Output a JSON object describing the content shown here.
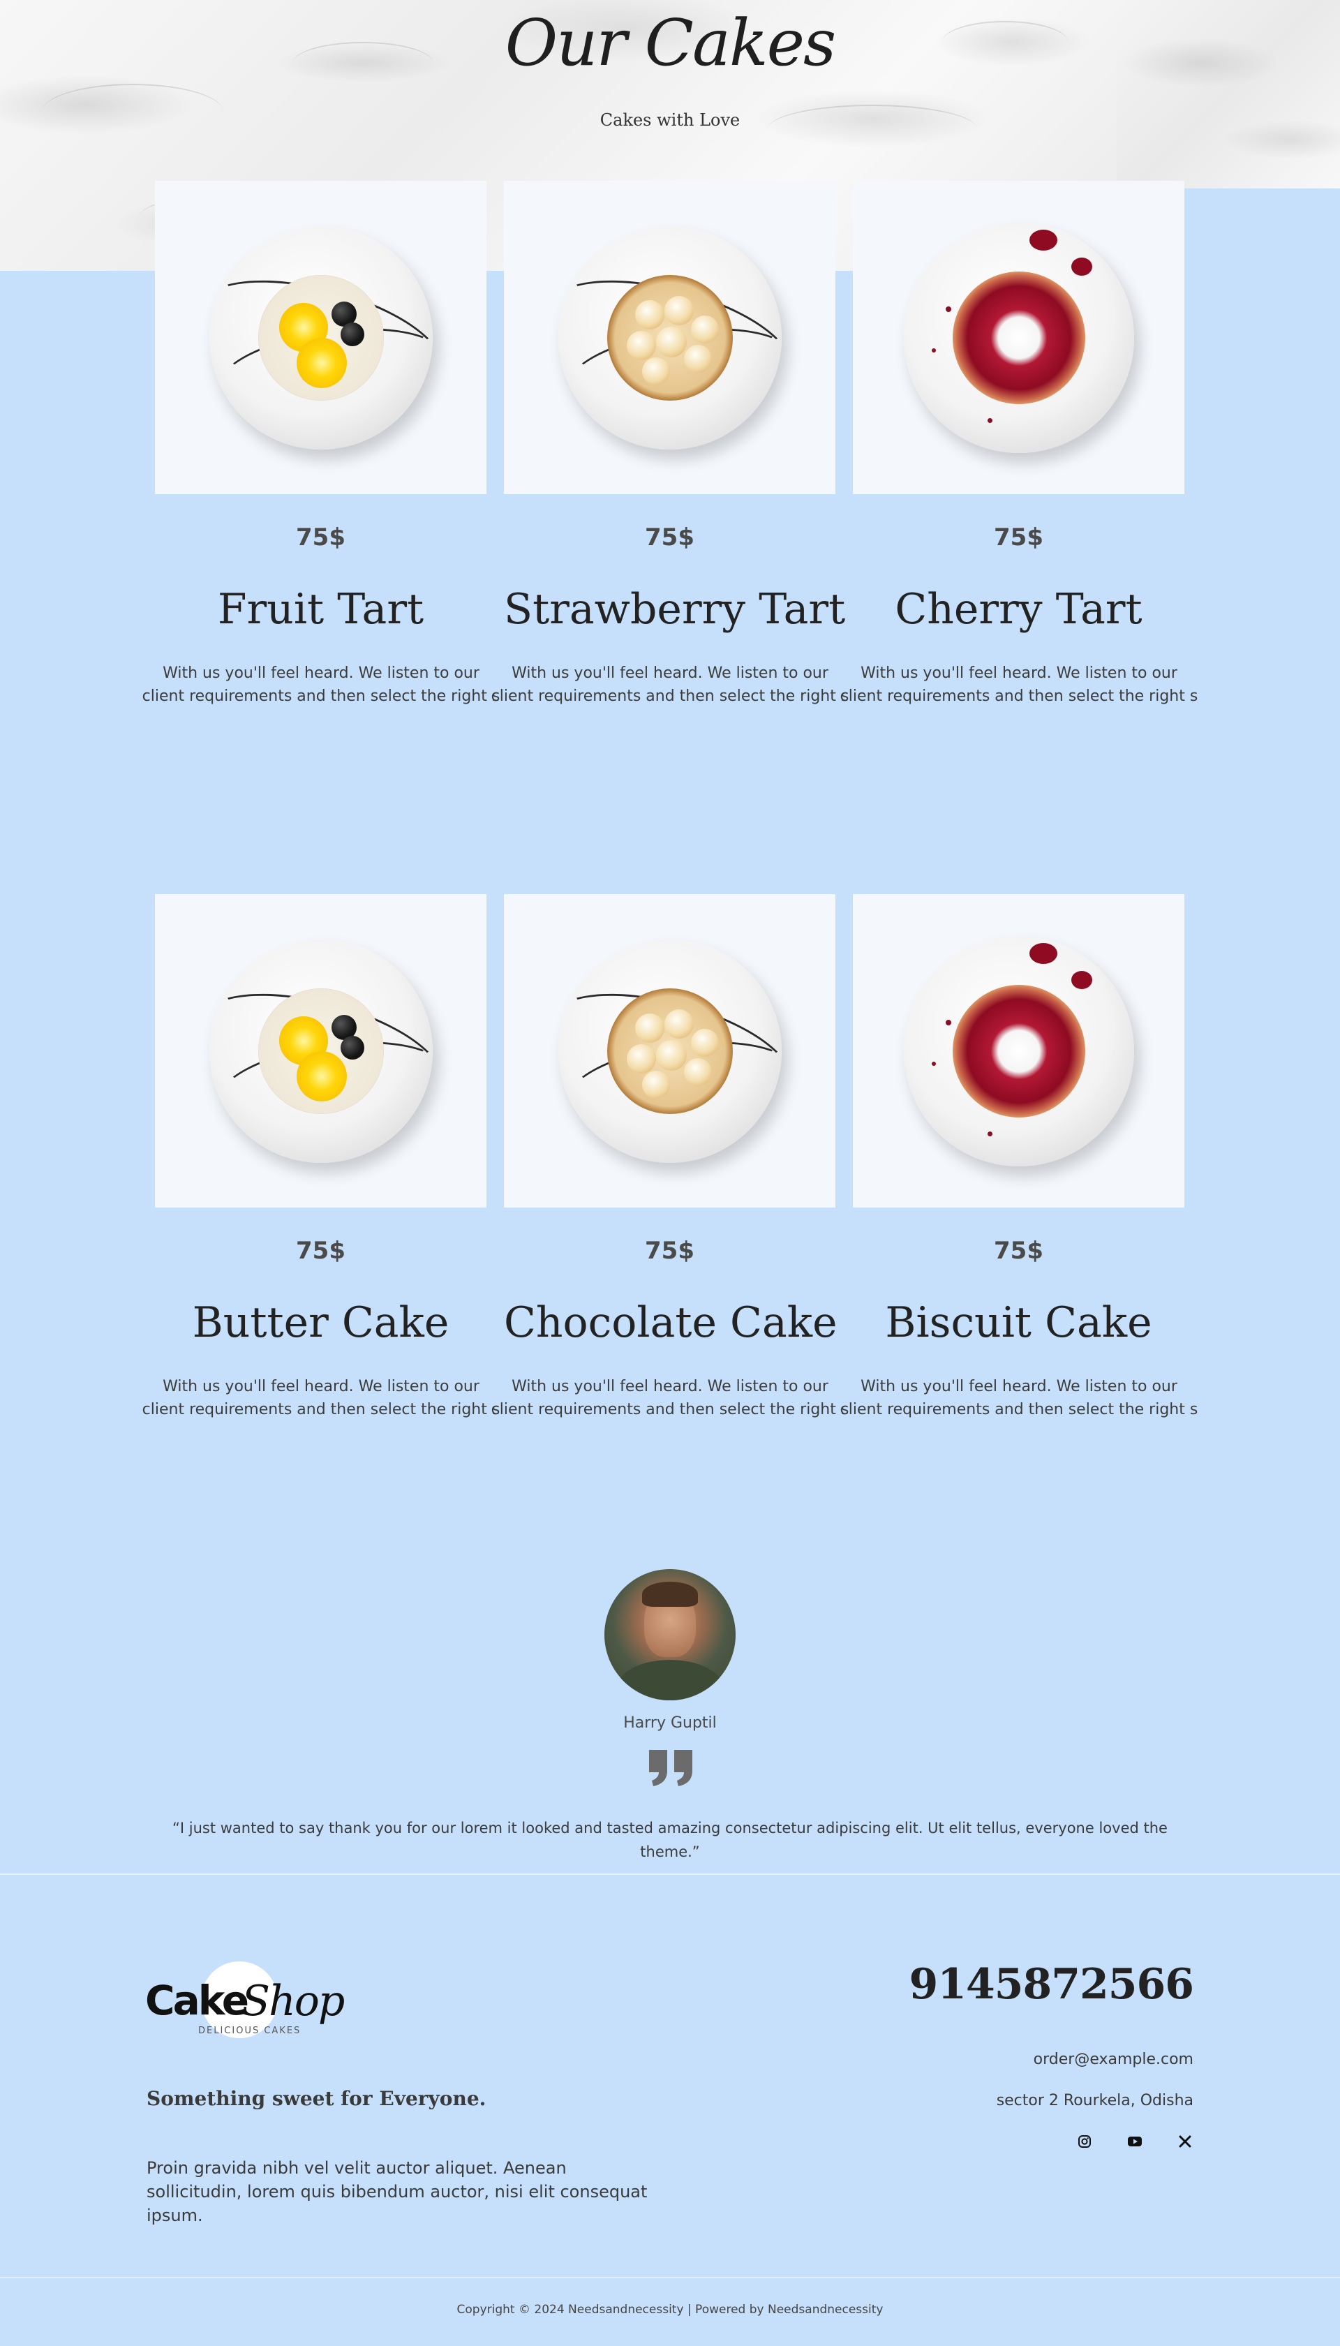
{
  "hero": {
    "title": "Our Cakes",
    "subtitle": "Cakes with Love"
  },
  "products": [
    {
      "name": "Fruit Tart",
      "price": "75$",
      "description": "With us you'll feel heard. We listen to our client requirements and then select the right s",
      "image": "fruit-tart-image"
    },
    {
      "name": "Strawberry Tart",
      "price": "75$",
      "description": "With us you'll feel heard. We listen to our client requirements and then select the right s",
      "image": "meringue-tart-image"
    },
    {
      "name": "Cherry Tart",
      "price": "75$",
      "description": "With us you'll feel heard. We listen to our client requirements and then select the right s",
      "image": "cherry-tart-image"
    },
    {
      "name": "Butter Cake",
      "price": "75$",
      "description": "With us you'll feel heard. We listen to our client requirements and then select the right s",
      "image": "fruit-tart-image"
    },
    {
      "name": "Chocolate Cake",
      "price": "75$",
      "description": "With us you'll feel heard. We listen to our client requirements and then select the right s",
      "image": "meringue-tart-image"
    },
    {
      "name": "Biscuit Cake",
      "price": "75$",
      "description": "With us you'll feel heard. We listen to our client requirements and then select the right s",
      "image": "cherry-tart-image"
    }
  ],
  "testimonial": {
    "name": "Harry Guptil",
    "quote": "“I just wanted to say thank you for our lorem it looked and tasted amazing consectetur adipiscing elit. Ut elit tellus, everyone loved the theme.”"
  },
  "footer": {
    "logo": {
      "word1": "Cake",
      "word2": "Shop",
      "tagline": "DELICIOUS CAKES"
    },
    "tagline": "Something sweet for Everyone.",
    "description": "Proin gravida nibh vel velit auctor aliquet. Aenean sollicitudin, lorem quis bibendum auctor, nisi elit consequat ipsum.",
    "phone": "9145872566",
    "email": "order@example.com",
    "address": "sector 2 Rourkela, Odisha",
    "social": [
      "instagram-icon",
      "youtube-icon",
      "x-icon"
    ],
    "copyright": "Copyright © 2024 Needsandnecessity | Powered by Needsandnecessity"
  },
  "colors": {
    "page_background": "#c6e0fb",
    "card_background": "#f4f8fd",
    "heading": "#222222",
    "text": "#3a3a3a"
  }
}
